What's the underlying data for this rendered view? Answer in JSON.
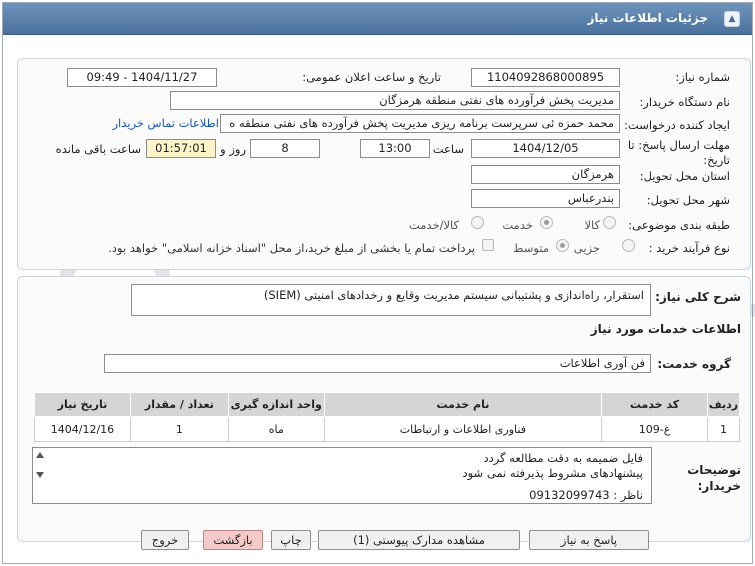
{
  "window": {
    "title": "جزئیات اطلاعات نیاز"
  },
  "header": {
    "need_number_label": "شماره نیاز:",
    "need_number": "1104092868000895",
    "announce_label": "تاریخ و ساعت اعلان عمومی:",
    "announce_value": "1404/11/27 - 09:49",
    "buyer_org_label": "نام دستگاه خریدار:",
    "buyer_org": "مدیریت پخش فرآورده های نفتی منطقه هرمزگان",
    "requester_label": "ایجاد کننده درخواست:",
    "requester": "محمد حمزه ئی سرپرست برنامه ریزی مدیریت پخش فرآورده های نفتی منطقه ه",
    "contact_link": "اطلاعات تماس خریدار",
    "deadline_label": "مهلت ارسال پاسخ: تا تاریخ:",
    "deadline_date": "1404/12/05",
    "time_label": "ساعت",
    "deadline_time": "13:00",
    "days_value": "8",
    "days_label": "روز و",
    "remaining_time": "01:57:01",
    "remaining_label": "ساعت باقی مانده",
    "province_label": "استان محل تحویل:",
    "province": "هرمزگان",
    "city_label": "شهر محل تحویل:",
    "city": "بندرعباس",
    "category_label": "طبقه بندی موضوعی:",
    "category_options": [
      "کالا",
      "خدمت",
      "کالا/خدمت"
    ],
    "category_selected": "خدمت",
    "process_label": "نوع فرآیند خرید :",
    "process_options": [
      "جزیی",
      "متوسط"
    ],
    "process_selected": "متوسط",
    "payment_note": "پرداخت تمام یا بخشی از مبلغ خرید،از محل \"اسناد خزانه اسلامی\" خواهد بود."
  },
  "description": {
    "label": "شرح کلی نیاز:",
    "text": "استقرار، راه‌اندازی و پشتیبانی سیستم مدیریت وقایع و رخدادهای امنیتی (SIEM)"
  },
  "services": {
    "heading": "اطلاعات خدمات مورد نیاز",
    "group_label": "گروه خدمت:",
    "group_value": "فن آوری اطلاعات",
    "columns": [
      "ردیف",
      "کد خدمت",
      "نام خدمت",
      "واحد اندازه گیری",
      "تعداد / مقدار",
      "تاریخ نیاز"
    ],
    "rows": [
      {
        "row": "1",
        "code": "غ-109",
        "name": "فناوری اطلاعات و ارتباطات",
        "unit": "ماه",
        "qty": "1",
        "date": "1404/12/16"
      }
    ]
  },
  "buyer_notes": {
    "label": "توضیحات خریدار:",
    "lines": [
      "فایل ضمیمه به دقت مطالعه گردد",
      "پیشنهادهای مشروط پذیرفته نمی شود",
      "",
      "ناظر : 09132099743"
    ]
  },
  "buttons": {
    "reply": "پاسخ به نیاز",
    "attachments": "مشاهده مدارک پیوستی (1)",
    "print": "چاپ",
    "back": "بازگشت",
    "exit": "خروج"
  },
  "watermark": "AriaTender.net",
  "colors": {
    "titlebar": "#5a80aa",
    "highlight": "#fdf5c9",
    "link": "#1a56b8",
    "exit_button": "#f3c9c9"
  }
}
